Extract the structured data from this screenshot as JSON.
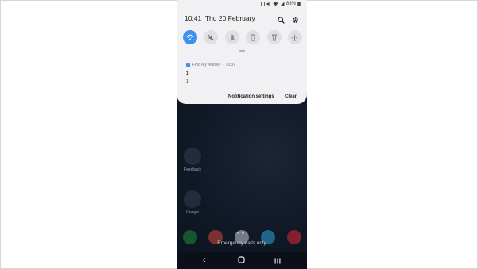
{
  "status_bar": {
    "battery": "83%"
  },
  "panel": {
    "time": "10:41",
    "date": "Thu 20 February",
    "toggles": [
      {
        "name": "wifi",
        "icon": "wifi-icon",
        "on": true
      },
      {
        "name": "sound",
        "icon": "mute-icon",
        "on": false
      },
      {
        "name": "bluetooth",
        "icon": "bluetooth-icon",
        "on": false
      },
      {
        "name": "rotation",
        "icon": "portrait-icon",
        "on": false
      },
      {
        "name": "flashlight",
        "icon": "flashlight-icon",
        "on": false
      },
      {
        "name": "airplane",
        "icon": "airplane-icon",
        "on": false
      }
    ]
  },
  "notification": {
    "app_name": "Find My Mobile",
    "time": "10:37",
    "title": "1",
    "text": "1",
    "settings_label": "Notification settings",
    "clear_label": "Clear"
  },
  "home": {
    "apps": [
      {
        "label": "Feedback"
      },
      {
        "label": "Google"
      }
    ],
    "emergency_text": "Emergency calls only"
  },
  "colors": {
    "accent": "#3e91f0",
    "panel_bg": "#f1f1f3",
    "home_bg": "#0e1624"
  }
}
